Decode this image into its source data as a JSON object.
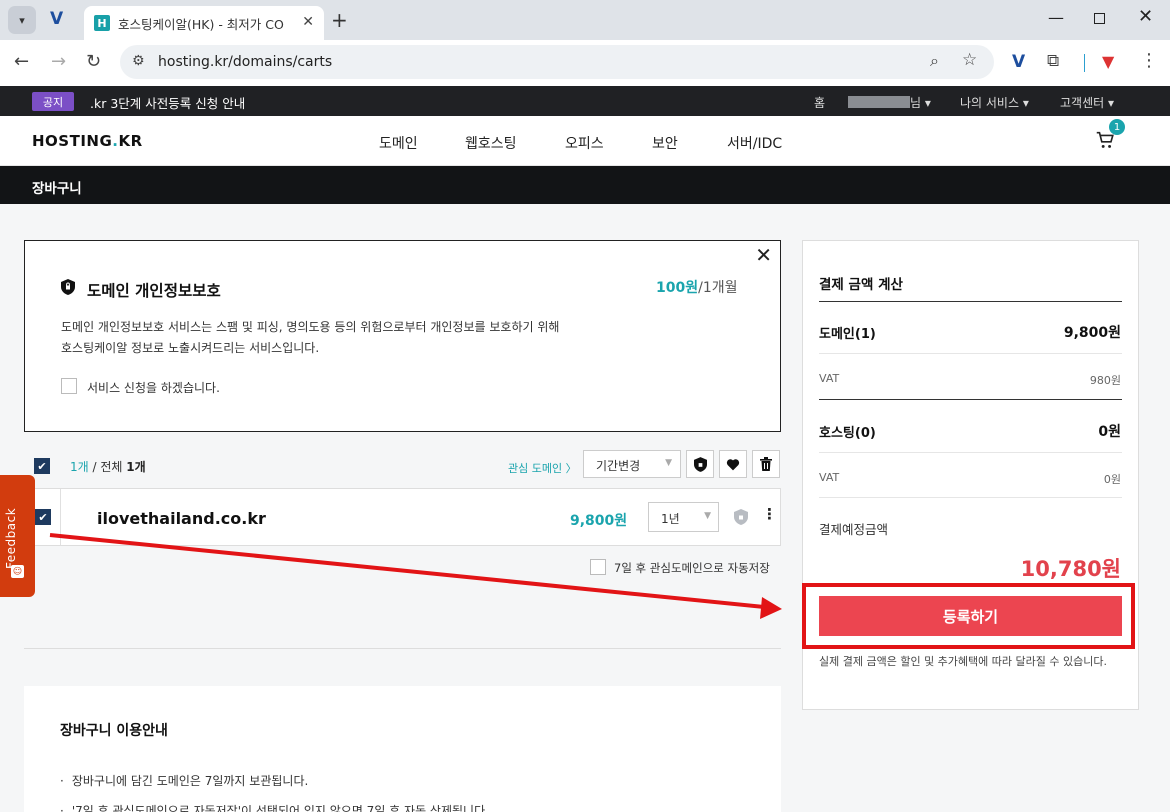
{
  "browser": {
    "tab_title": "호스팅케이알(HK) - 최저가 CO",
    "favicon_letter": "H",
    "url": "hosting.kr/domains/carts",
    "icons": [
      "tab-search-icon",
      "extension-v-icon",
      "close-icon",
      "new-tab-icon",
      "back-icon",
      "forward-icon",
      "reload-icon",
      "site-settings-icon",
      "zoom-icon",
      "star-icon",
      "puzzle-icon",
      "popcorn-icon",
      "kebab-menu-icon"
    ]
  },
  "notice": {
    "badge": "공지",
    "text": ".kr 3단계 사전등록 신청 안내"
  },
  "top_menu": {
    "home": "홈",
    "user_suffix": "님 ▾",
    "my_service": "나의 서비스 ▾",
    "support": "고객센터 ▾"
  },
  "gnb": {
    "logo_a": "HOSTING",
    "logo_dot": ".",
    "logo_b": "KR",
    "items": [
      "도메인",
      "웹호스팅",
      "오피스",
      "보안",
      "서버/IDC"
    ],
    "cart_count": "1"
  },
  "subhead": {
    "title": "장바구니"
  },
  "privacy": {
    "title": "도메인 개인정보보호",
    "price": "100원",
    "period": "/1개월",
    "desc_line1": "도메인 개인정보보호 서비스는 스팸 및 피싱, 명의도용 등의 위험으로부터 개인정보를 보호하기 위해",
    "desc_line2": "호스팅케이알 정보로 노출시켜드리는 서비스입니다.",
    "check_label": "서비스 신청을 하겠습니다."
  },
  "list": {
    "selected_count": "1개",
    "total_prefix": " / 전체 ",
    "total_count": "1개",
    "fav_link": "관심 도메인 〉",
    "period_select": "기간변경",
    "autosave_label": "7일 후 관심도메인으로 자동저장"
  },
  "domain_row": {
    "name": "ilovethailand.co.kr",
    "price": "9,800원",
    "years": "1년"
  },
  "guide": {
    "title": "장바구니 이용안내",
    "items": [
      "장바구니에 담긴 도메인은 7일까지 보관됩니다.",
      "'7일 후 관심도메인으로 자동저장'이 선택되어 있지 않으면 7일 후 자동 삭제됩니다."
    ]
  },
  "summary": {
    "title": "결제 금액 계산",
    "domain_label": "도메인(1)",
    "domain_value": "9,800원",
    "domain_vat_label": "VAT",
    "domain_vat_value": "980원",
    "hosting_label": "호스팅(0)",
    "hosting_value": "0원",
    "hosting_vat_label": "VAT",
    "hosting_vat_value": "0원",
    "total_label": "결제예정금액",
    "total_value": "10,780원",
    "register_button": "등록하기",
    "note": "실제 결제 금액은 할인 및 추가혜택에 따라 달라질 수 있습니다."
  },
  "feedback": {
    "label": "Feedback"
  },
  "colors": {
    "accent_teal": "#1aa4ad",
    "register_red": "#ec4550",
    "total_red": "#e2424c",
    "annotation_red": "#e21416",
    "notice_purple": "#7b4fc6"
  }
}
